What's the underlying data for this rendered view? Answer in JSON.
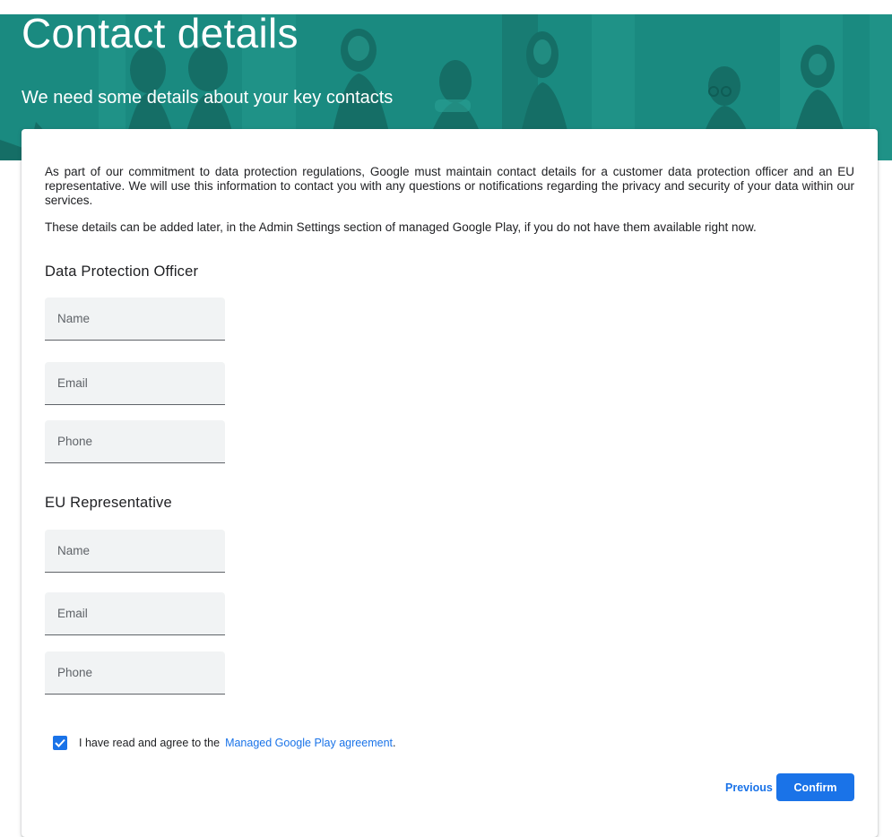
{
  "header": {
    "title": "Contact details",
    "subtitle": "We need some details about your key contacts"
  },
  "intro": {
    "paragraph1": "As part of our commitment to data protection regulations, Google must maintain contact details for a customer data protection officer and an EU representative. We will use this information to contact you with any questions or notifications regarding the privacy and security of your data within our services.",
    "paragraph2": "These details can be added later, in the Admin Settings section of managed Google Play, if you do not have them available right now."
  },
  "dpo": {
    "title": "Data Protection Officer",
    "name_placeholder": "Name",
    "email_placeholder": "Email",
    "phone_placeholder": "Phone"
  },
  "eu_rep": {
    "title": "EU Representative",
    "name_placeholder": "Name",
    "email_placeholder": "Email",
    "phone_placeholder": "Phone"
  },
  "agreement": {
    "checked": true,
    "text": "I have read and agree to the",
    "link_text": "Managed Google Play agreement",
    "suffix": "."
  },
  "actions": {
    "previous_label": "Previous",
    "confirm_label": "Confirm"
  },
  "icons": {
    "checkbox": "checkmark-icon",
    "banner": "people-illustration"
  },
  "colors": {
    "banner": "#1a8a80",
    "accent": "#1a73e8",
    "field_bg": "#f1f3f4"
  }
}
